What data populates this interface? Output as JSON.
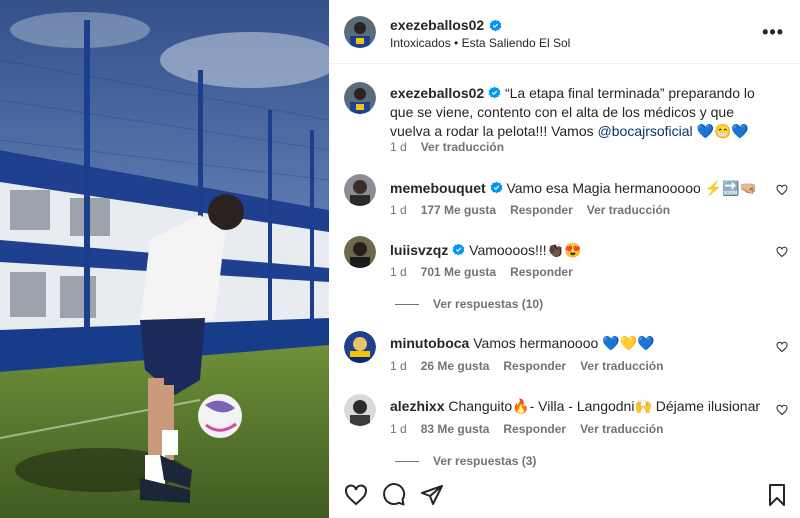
{
  "post": {
    "author": "exezeballos02",
    "audio": "Intoxicados • Esta Saliendo El Sol",
    "caption": {
      "author": "exezeballos02",
      "text_before_link": "“La etapa final terminada” preparando lo que se viene, contento con el alta de los médicos y que vuelva a rodar la pelota!!! Vamos ",
      "link": "@bocajrsoficial",
      "emojis": "💙😁💙",
      "time": "1 d",
      "translate": "Ver traducción"
    }
  },
  "comments": [
    {
      "user": "memebouquet",
      "verified": true,
      "text": "Vamo esa Magia hermanooooo ⚡️🔜🤜🏼",
      "time": "1 d",
      "likes": "177 Me gusta",
      "reply": "Responder",
      "translate": "Ver traducción"
    },
    {
      "user": "luiisvzqz",
      "verified": true,
      "text": "Vamoooos!!!👏🏿😍",
      "time": "1 d",
      "likes": "701 Me gusta",
      "reply": "Responder",
      "view_replies": "Ver respuestas (10)"
    },
    {
      "user": "minutoboca",
      "verified": false,
      "text": "Vamos hermanoooo 💙💛💙",
      "time": "1 d",
      "likes": "26 Me gusta",
      "reply": "Responder",
      "translate": "Ver traducción"
    },
    {
      "user": "alezhixx",
      "verified": false,
      "text": "Changuito🔥- Villa - Langodni🙌 Déjame ilusionar",
      "time": "1 d",
      "likes": "83 Me gusta",
      "reply": "Responder",
      "translate": "Ver traducción",
      "view_replies": "Ver respuestas (3)"
    }
  ],
  "icons": {
    "more": "more-options-icon",
    "like": "heart-icon",
    "comment": "comment-icon",
    "share": "share-icon",
    "save": "bookmark-icon",
    "verified": "verified-badge-icon"
  },
  "colors": {
    "verified": "#0095f6",
    "link": "#00376b",
    "meta": "#737373"
  }
}
